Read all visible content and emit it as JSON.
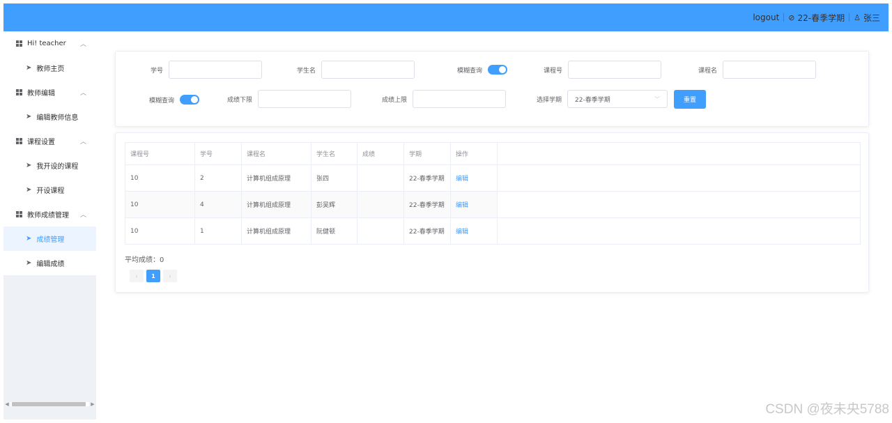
{
  "header": {
    "logout": "logout",
    "semester": "22-春季学期",
    "user": "张三"
  },
  "sidebar": {
    "groups": [
      {
        "label": "Hi! teacher",
        "items": [
          "教师主页"
        ]
      },
      {
        "label": "教师编辑",
        "items": [
          "编辑教师信息"
        ]
      },
      {
        "label": "课程设置",
        "items": [
          "我开设的课程",
          "开设课程"
        ]
      },
      {
        "label": "教师成绩管理",
        "items": [
          "成绩管理",
          "编辑成绩"
        ]
      }
    ],
    "active_item": "成绩管理"
  },
  "search": {
    "student_id_label": "学号",
    "student_name_label": "学生名",
    "fuzzy_label_1": "模糊查询",
    "course_id_label": "课程号",
    "course_name_label": "课程名",
    "fuzzy_label_2": "模糊查询",
    "score_min_label": "成绩下限",
    "score_max_label": "成绩上限",
    "semester_label": "选择学期",
    "semester_value": "22-春季学期",
    "reset_label": "重置"
  },
  "table": {
    "columns": [
      "课程号",
      "学号",
      "课程名",
      "学生名",
      "成绩",
      "学期",
      "操作"
    ],
    "rows": [
      {
        "course_id": "10",
        "student_id": "2",
        "course_name": "计算机组成原理",
        "student_name": "张四",
        "score": "",
        "semester": "22-春季学期",
        "op": "编辑"
      },
      {
        "course_id": "10",
        "student_id": "4",
        "course_name": "计算机组成原理",
        "student_name": "彭吴辉",
        "score": "",
        "semester": "22-春季学期",
        "op": "编辑"
      },
      {
        "course_id": "10",
        "student_id": "1",
        "course_name": "计算机组成原理",
        "student_name": "阮健顿",
        "score": "",
        "semester": "22-春季学期",
        "op": "编辑"
      }
    ]
  },
  "average": "平均成绩：0",
  "pager": {
    "prev": "‹",
    "current": "1",
    "next": "›"
  },
  "watermark": "CSDN @夜未央5788",
  "colors": {
    "primary": "#409eff",
    "sidebar_bg": "#eef1f6"
  }
}
